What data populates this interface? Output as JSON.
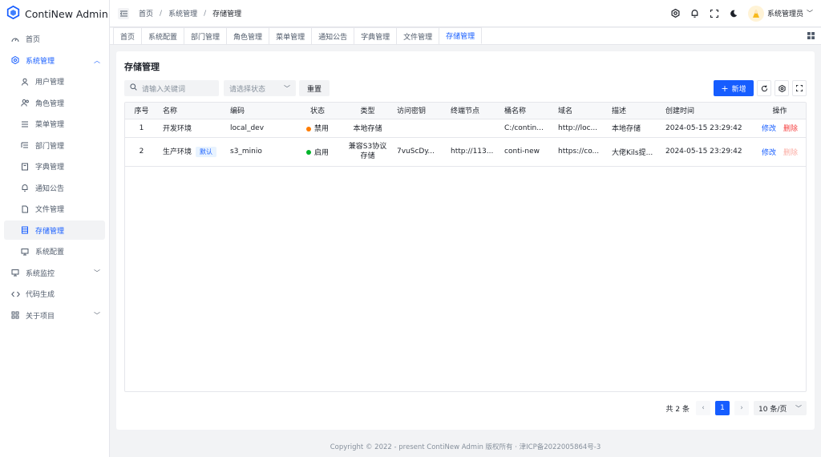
{
  "app": {
    "title": "ContiNew Admin",
    "brand_color": "#165dff"
  },
  "sidebar": {
    "items": [
      {
        "label": "首页",
        "icon": "dashboard-icon"
      },
      {
        "label": "系统管理",
        "icon": "gear-icon",
        "open": true
      },
      {
        "label": "用户管理",
        "icon": "user-icon"
      },
      {
        "label": "角色管理",
        "icon": "users-icon"
      },
      {
        "label": "菜单管理",
        "icon": "menu-icon"
      },
      {
        "label": "部门管理",
        "icon": "list-icon"
      },
      {
        "label": "字典管理",
        "icon": "book-icon"
      },
      {
        "label": "通知公告",
        "icon": "bell-icon"
      },
      {
        "label": "文件管理",
        "icon": "file-icon"
      },
      {
        "label": "存储管理",
        "icon": "storage-icon",
        "active": true
      },
      {
        "label": "系统配置",
        "icon": "monitor-icon"
      },
      {
        "label": "系统监控",
        "icon": "monitor-icon"
      },
      {
        "label": "代码生成",
        "icon": "code-icon"
      },
      {
        "label": "关于项目",
        "icon": "apps-icon"
      }
    ]
  },
  "header": {
    "breadcrumb": [
      "首页",
      "系统管理",
      "存储管理"
    ],
    "user_name": "系统管理员"
  },
  "tabs": [
    "首页",
    "系统配置",
    "部门管理",
    "角色管理",
    "菜单管理",
    "通知公告",
    "字典管理",
    "文件管理",
    "存储管理"
  ],
  "page": {
    "title": "存储管理",
    "search_placeholder": "请输入关键词",
    "status_placeholder": "请选择状态",
    "reset_label": "重置",
    "add_label": "新增"
  },
  "table": {
    "columns": [
      "序号",
      "名称",
      "编码",
      "状态",
      "类型",
      "访问密钥",
      "终端节点",
      "桶名称",
      "域名",
      "描述",
      "创建时间",
      "操作"
    ],
    "rows": [
      {
        "index": "1",
        "name": "开发环境",
        "default_tag": "",
        "code": "local_dev",
        "status": "禁用",
        "status_color": "#ff7d00",
        "type": "本地存储",
        "access_key": "",
        "endpoint": "",
        "bucket": "C:/contin...",
        "domain": "http://loc...",
        "description": "本地存储",
        "created": "2024-05-15 23:29:42",
        "edit": "修改",
        "delete": "删除"
      },
      {
        "index": "2",
        "name": "生产环境",
        "default_tag": "默认",
        "code": "s3_minio",
        "status": "启用",
        "status_color": "#00b42a",
        "type": "兼容S3协议存储",
        "access_key": "7vuScDy...",
        "endpoint": "http://113...",
        "bucket": "conti-new",
        "domain": "https://co...",
        "description": "大佬Kils提...",
        "created": "2024-05-15 23:29:42",
        "edit": "修改",
        "delete": "删除"
      }
    ]
  },
  "pagination": {
    "total": "共 2 条",
    "current": "1",
    "page_size": "10 条/页"
  },
  "footer": {
    "text": "Copyright © 2022 - present ContiNew Admin 版权所有 · 津ICP备2022005864号-3"
  }
}
